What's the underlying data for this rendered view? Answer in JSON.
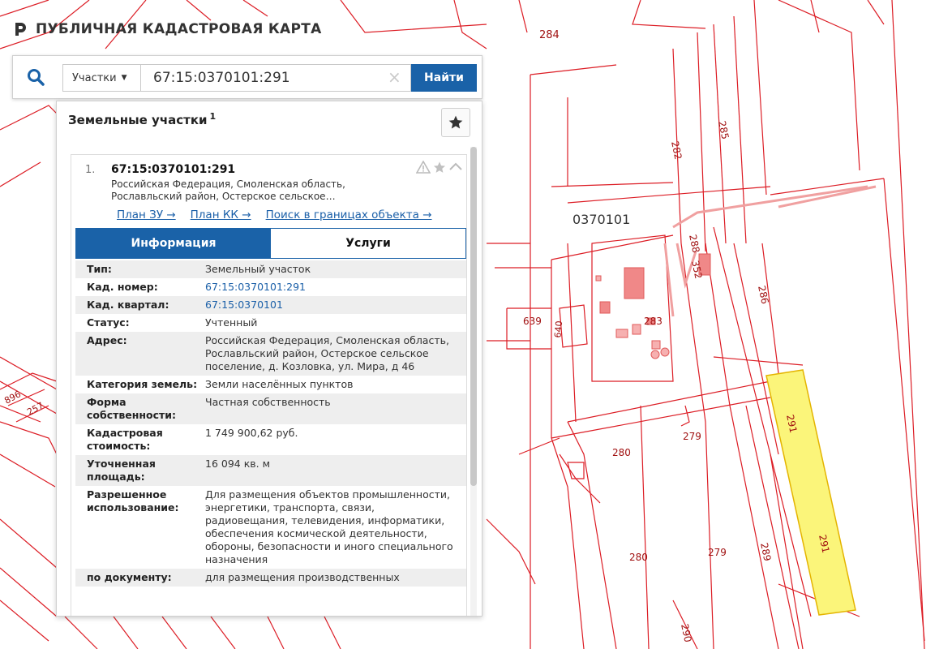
{
  "app": {
    "title": "ПУБЛИЧНАЯ КАДАСТРОВАЯ КАРТА"
  },
  "search": {
    "type_label": "Участки",
    "query": "67:15:0370101:291",
    "clear_glyph": "×",
    "find_label": "Найти"
  },
  "panel": {
    "title": "Земельные участки",
    "count": "1"
  },
  "item": {
    "index": "1.",
    "cad_number": "67:15:0370101:291",
    "address_short_line1": "Российская Федерация, Смоленская область,",
    "address_short_line2": "Рославльский район, Остерское сельское…",
    "links": {
      "plan_zu": "План ЗУ →",
      "plan_kk": "План КК →",
      "search_bounds": "Поиск в границах объекта →"
    }
  },
  "tabs": {
    "info": "Информация",
    "services": "Услуги"
  },
  "details": [
    {
      "key": "Тип:",
      "value": "Земельный участок"
    },
    {
      "key": "Кад. номер:",
      "value": "67:15:0370101:291"
    },
    {
      "key": "Кад. квартал:",
      "value": "67:15:0370101"
    },
    {
      "key": "Статус:",
      "value": "Учтенный"
    },
    {
      "key": "Адрес:",
      "value": "Российская Федерация, Смоленская область, Рославльский район, Остерское сельское поселение, д. Козловка, ул. Мира, д 46"
    },
    {
      "key": "Категория земель:",
      "value": "Земли населённых пунктов"
    },
    {
      "key": "Форма собственности:",
      "value": "Частная собственность"
    },
    {
      "key": "Кадастровая стоимость:",
      "value": "1 749 900,62 руб."
    },
    {
      "key": "Уточненная площадь:",
      "value": "16 094 кв. м"
    },
    {
      "key": "Разрешенное использование:",
      "value": "Для размещения объектов промышленности, энергетики, транспорта, связи, радиовещания, телевидения, информатики, обеспечения космической деятельности, обороны, безопасности и иного специального назначения"
    },
    {
      "key": "по документу:",
      "value": "для размещения производственных"
    }
  ],
  "map": {
    "block_label": "0370101",
    "parcel_labels": [
      "284",
      "282",
      "285",
      "288",
      "352",
      "286",
      "283",
      "639",
      "640",
      "291",
      "291",
      "279",
      "280",
      "280",
      "279",
      "289",
      "290",
      "896",
      "257"
    ],
    "colors": {
      "boundary": "#dc1c24",
      "highlight": "#fbf57a",
      "accent": "#1a62a8"
    }
  }
}
